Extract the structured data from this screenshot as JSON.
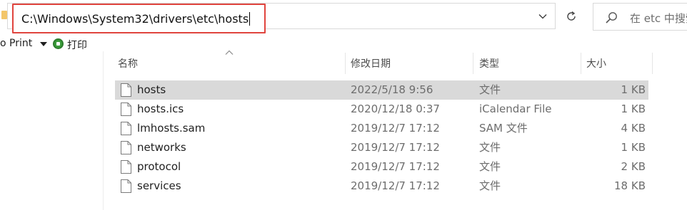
{
  "address_bar": {
    "path": "C:\\Windows\\System32\\drivers\\etc\\hosts"
  },
  "search": {
    "placeholder": "在 etc 中搜索"
  },
  "command_bar": {
    "print_menu_label": "o Print",
    "print_button_label": "打印"
  },
  "columns": {
    "name": "名称",
    "date_modified": "修改日期",
    "type": "类型",
    "size": "大小"
  },
  "files": [
    {
      "name": "hosts",
      "date": "2022/5/18 9:56",
      "type": "文件",
      "size": "1 KB",
      "selected": true
    },
    {
      "name": "hosts.ics",
      "date": "2020/12/18 0:37",
      "type": "iCalendar File",
      "size": "1 KB",
      "selected": false
    },
    {
      "name": "lmhosts.sam",
      "date": "2019/12/7 17:12",
      "type": "SAM 文件",
      "size": "4 KB",
      "selected": false
    },
    {
      "name": "networks",
      "date": "2019/12/7 17:12",
      "type": "文件",
      "size": "1 KB",
      "selected": false
    },
    {
      "name": "protocol",
      "date": "2019/12/7 17:12",
      "type": "文件",
      "size": "2 KB",
      "selected": false
    },
    {
      "name": "services",
      "date": "2019/12/7 17:12",
      "type": "文件",
      "size": "18 KB",
      "selected": false
    }
  ],
  "icons": {
    "folder": "folder-icon",
    "dropdown": "chevron-down-icon",
    "refresh": "refresh-icon",
    "search": "search-icon",
    "printer": "printer-icon",
    "sort": "sort-ascending-icon",
    "file": "file-icon"
  },
  "colors": {
    "highlight_border": "#e0443e",
    "selected_row": "#d9d9d9",
    "printer_icon": "#3a9b3a"
  }
}
